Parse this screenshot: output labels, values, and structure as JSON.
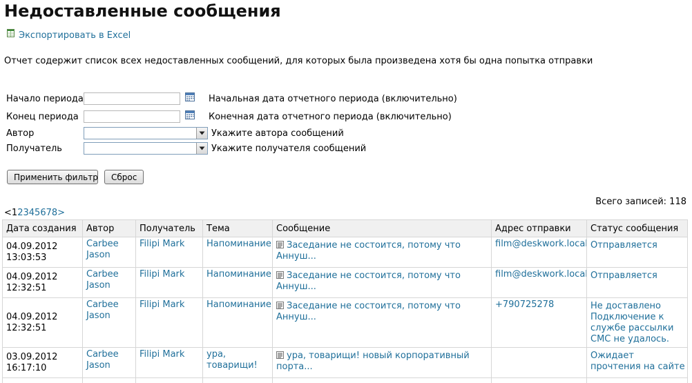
{
  "page": {
    "title": "Недоставленные сообщения",
    "export_label": "Экспортировать в Excel",
    "description": "Отчет содержит список всех недоставленных сообщений, для которых была произведена хотя бы одна попытка отправки"
  },
  "filters": {
    "start": {
      "label": "Начало периода",
      "value": "",
      "hint": "Начальная дата отчетного периода (включительно)"
    },
    "end": {
      "label": "Конец периода",
      "value": "",
      "hint": "Конечная дата отчетного периода (включительно)"
    },
    "author": {
      "label": "Автор",
      "value": "",
      "hint": "Укажите автора сообщений"
    },
    "recipient": {
      "label": "Получатель",
      "value": "",
      "hint": "Укажите получателя сообщений"
    },
    "apply_label": "Применить фильтр",
    "reset_label": "Сброс"
  },
  "summary": {
    "total_label": "Всего записей:",
    "total_value": "118"
  },
  "pager": {
    "prev": "<",
    "current": "1",
    "pages": [
      "2",
      "3",
      "4",
      "5",
      "6",
      "7",
      "8"
    ],
    "next": ">"
  },
  "table": {
    "columns": [
      "Дата создания",
      "Автор",
      "Получатель",
      "Тема",
      "Сообщение",
      "Адрес отправки",
      "Статус сообщения"
    ],
    "rows": [
      {
        "date": "04.09.2012",
        "time": "13:03:53",
        "author": "Carbee Jason",
        "recipient": "Filipi Mark",
        "subject": "Напоминание",
        "message": "Заседание не состоится, потому что Аннуш...",
        "address": "film@deskwork.local",
        "status": "Отправляется"
      },
      {
        "date": "04.09.2012",
        "time": "12:32:51",
        "author": "Carbee Jason",
        "recipient": "Filipi Mark",
        "subject": "Напоминание",
        "message": "Заседание не состоится, потому что Аннуш...",
        "address": "film@deskwork.local",
        "status": "Отправляется"
      },
      {
        "date": "04.09.2012",
        "time": "12:32:51",
        "author": "Carbee Jason",
        "recipient": "Filipi Mark",
        "subject": "Напоминание",
        "message": "Заседание не состоится, потому что Аннуш...",
        "address": "+790725278",
        "status": "Не доставлено Подключение к службе рассылки СМС не удалось."
      },
      {
        "date": "03.09.2012",
        "time": "16:17:10",
        "author": "Carbee Jason",
        "recipient": "Filipi Mark",
        "subject": "ура, товарищи!",
        "message": "ура, товарищи! новый корпоративный порта...",
        "address": "",
        "status": "Ожидает прочтения на сайте"
      },
      {
        "date": "",
        "time": "",
        "author": "",
        "recipient": "",
        "subject": "",
        "message": "",
        "address": "",
        "status": ""
      }
    ]
  },
  "colors": {
    "link": "#1f6f9a",
    "header_bg": "#f0f0f0",
    "grid_border": "#d6d6d6"
  },
  "icons": {
    "export": "excel-icon",
    "calendar": "calendar-icon",
    "dropdown": "chevron-down-icon",
    "message": "message-icon"
  }
}
